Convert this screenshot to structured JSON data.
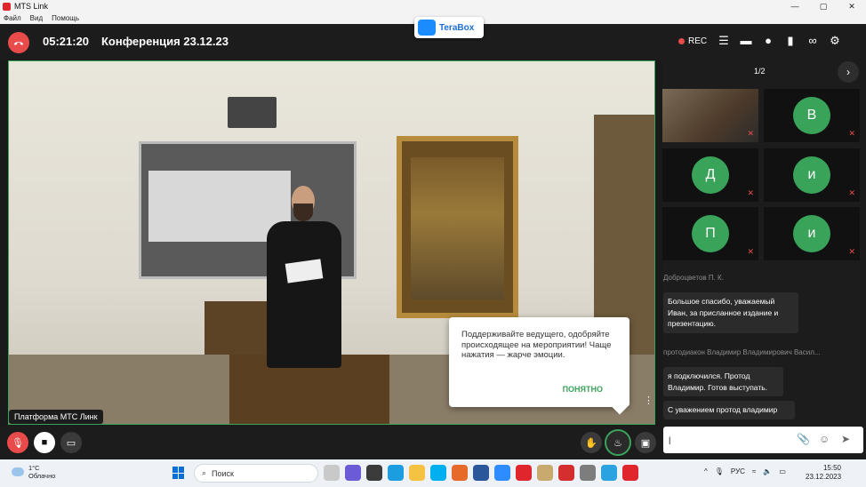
{
  "window": {
    "title": "MTS Link",
    "controls": [
      "—",
      "▢",
      "✕"
    ]
  },
  "menu": [
    "Файл",
    "Вид",
    "Помощь"
  ],
  "header": {
    "timer": "05:21:20",
    "title": "Конференция 23.12.23",
    "terabox": "TeraBox",
    "rec_label": "REC"
  },
  "video": {
    "label": "Платформа МТС Линк"
  },
  "popup": {
    "text": "Поддерживайте ведущего, одобряйте происходящее на мероприятии! Чаще нажатия — жарче эмоции.",
    "ok_label": "ПОНЯТНО"
  },
  "participants": {
    "pager": "1/2",
    "tiles": [
      {
        "initial": ""
      },
      {
        "initial": "В"
      },
      {
        "initial": "Д"
      },
      {
        "initial": "и"
      },
      {
        "initial": "П"
      },
      {
        "initial": "и"
      }
    ]
  },
  "chat": {
    "messages": [
      {
        "sender": "Доброцветов П. К.",
        "text": "Большое спасибо, уважаемый Иван, за присланное издание и презентацию."
      },
      {
        "sender": "протодиакон Владимир Владимирович Васил...",
        "text": "я подключился. Протод Владимир. Готов выступать."
      },
      {
        "sender": "",
        "text": "С уважением протод владимир"
      }
    ],
    "input_value": "|"
  },
  "taskbar": {
    "weather_temp": "1°C",
    "weather_desc": "Облачно",
    "search_placeholder": "Поиск",
    "lang": "РУС",
    "time": "15:50",
    "date": "23.12.2023"
  },
  "colors": {
    "accent_green": "#3aa35a",
    "hangup_red": "#e94b4b",
    "panel_bg": "#1c1c1c"
  }
}
